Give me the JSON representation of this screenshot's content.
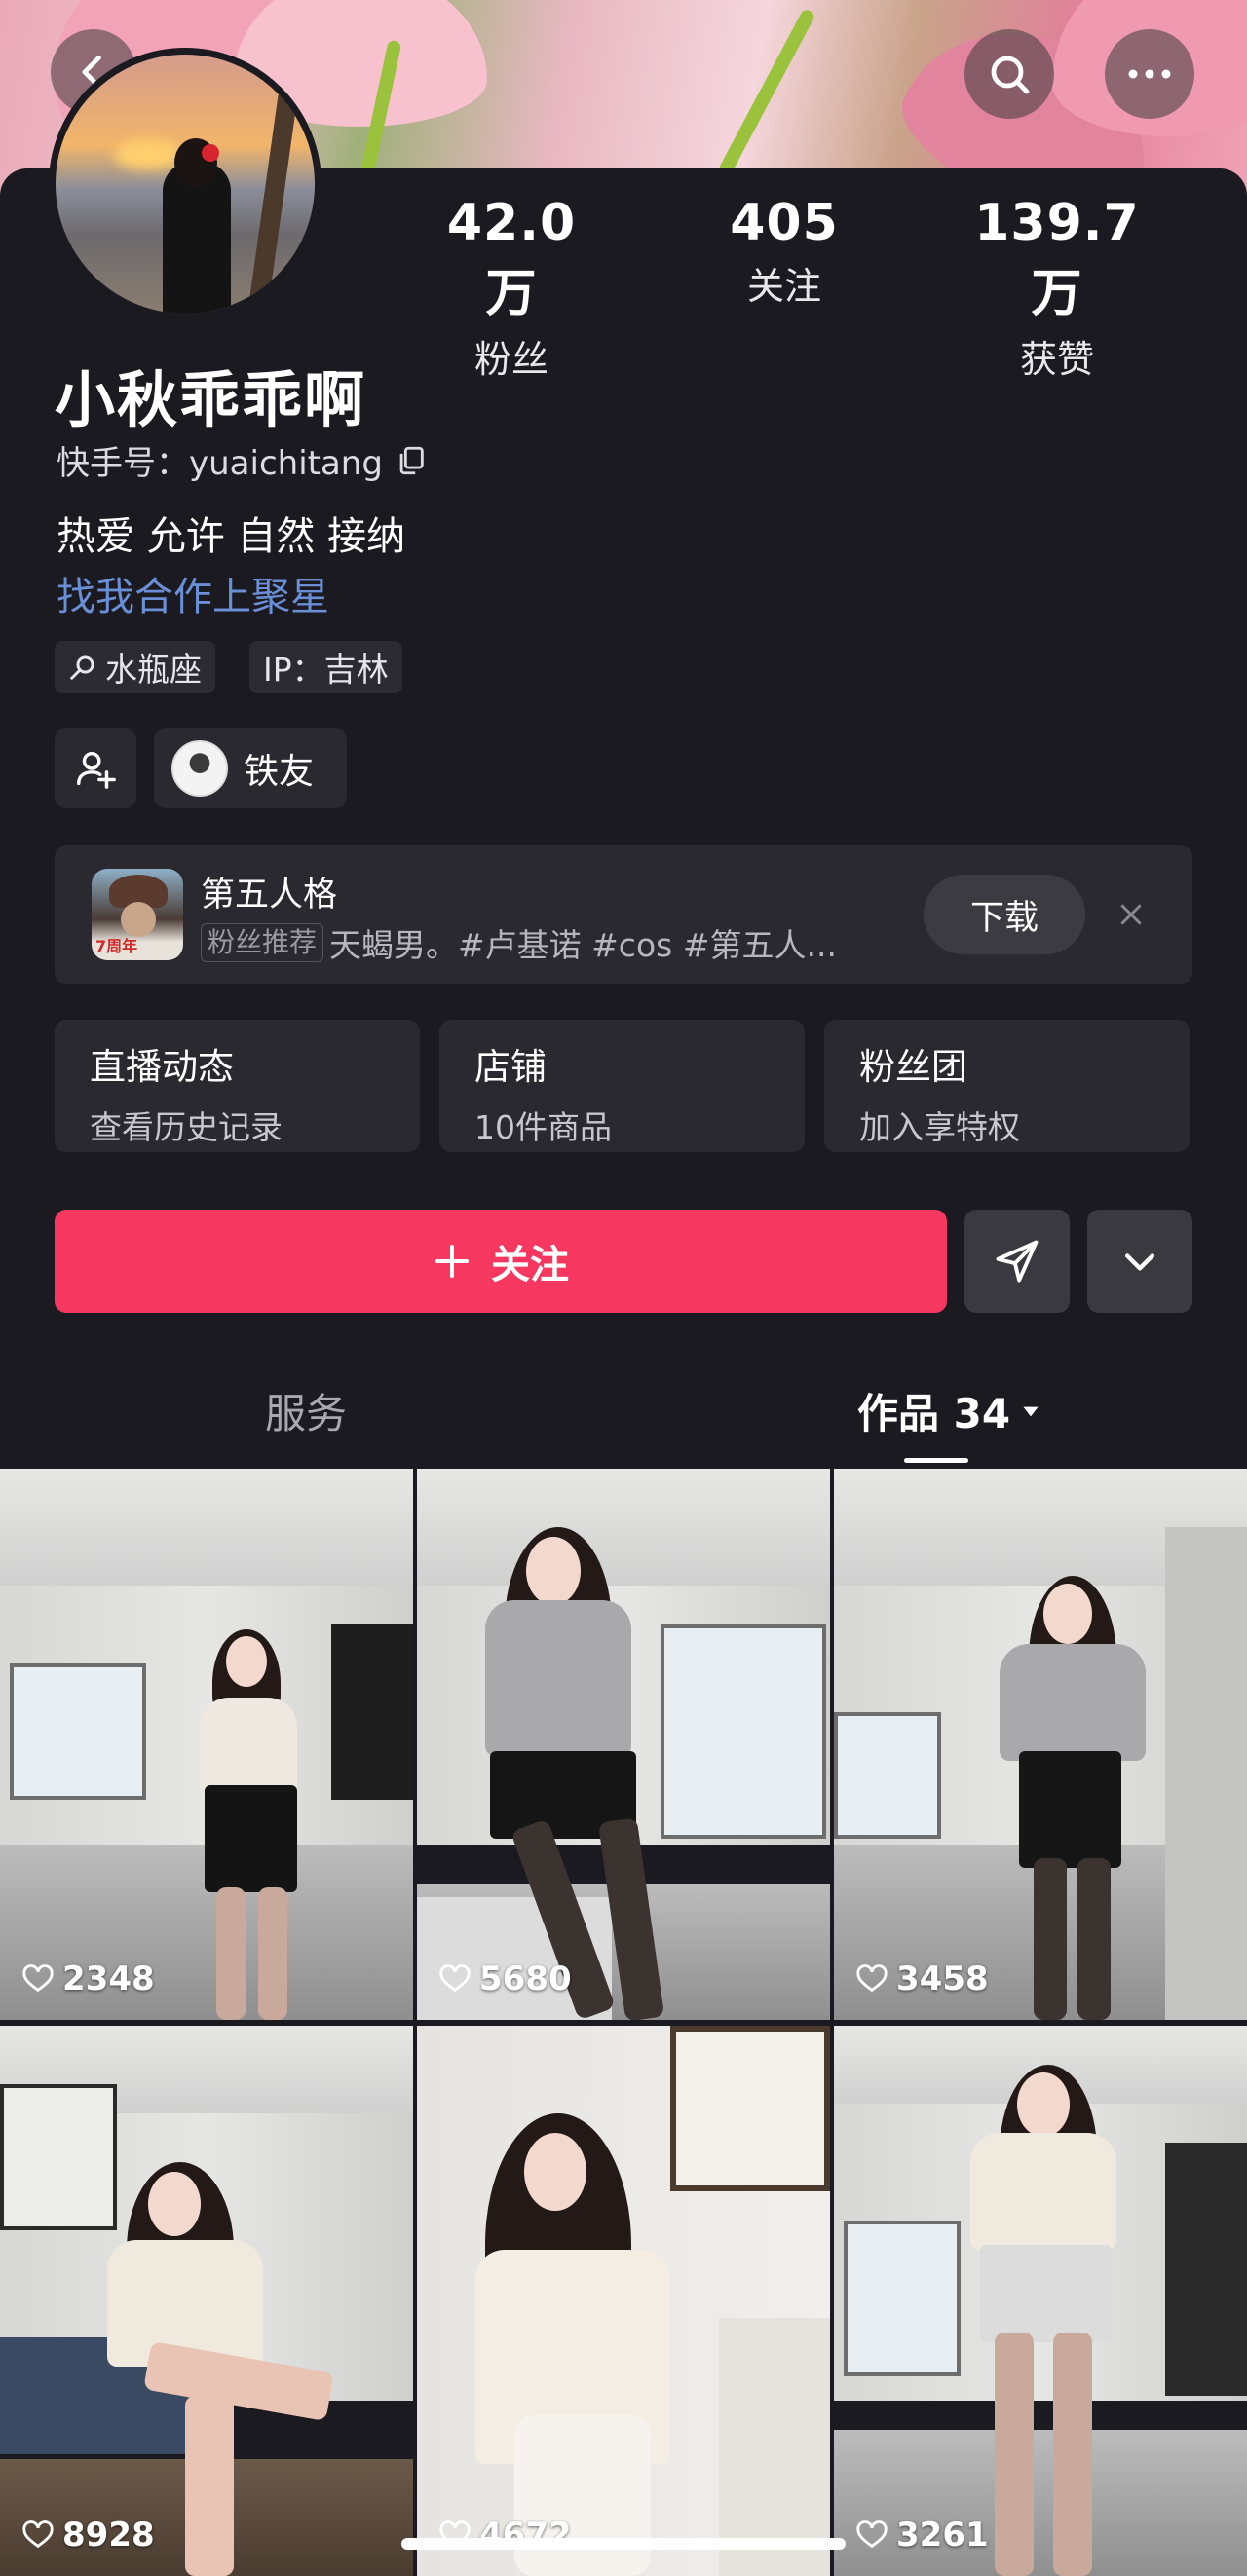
{
  "header": {
    "back_icon": "chevron-left-icon",
    "search_icon": "search-icon",
    "more_icon": "more-dots-icon"
  },
  "profile": {
    "stats": [
      {
        "value": "42.0万",
        "label": "粉丝"
      },
      {
        "value": "405",
        "label": "关注"
      },
      {
        "value": "139.7万",
        "label": "获赞"
      }
    ],
    "name": "小秋乖乖啊",
    "kuaishou_id": "快手号：yuaichitang",
    "bio": "热爱 允许 自然 接纳",
    "link": "找我合作上聚星",
    "tags": [
      "水瓶座",
      "IP：吉林"
    ],
    "friend_label": "铁友"
  },
  "ad": {
    "title": "第五人格",
    "chip": "粉丝推荐",
    "desc": "天蝎男。#卢基诺 #cos #第五人...",
    "download": "下载",
    "badge": "7周年"
  },
  "tiles": [
    {
      "title": "直播动态",
      "sub": "查看历史记录"
    },
    {
      "title": "店铺",
      "sub": "10件商品"
    },
    {
      "title": "粉丝团",
      "sub": "加入享特权"
    }
  ],
  "actions": {
    "follow": "关注"
  },
  "tabs": {
    "services": "服务",
    "works": "作品 34"
  },
  "videos": [
    {
      "likes": "2348"
    },
    {
      "likes": "5680"
    },
    {
      "likes": "3458"
    },
    {
      "likes": "8928"
    },
    {
      "likes": "4672"
    },
    {
      "likes": "3261"
    }
  ],
  "colors": {
    "background": "#1b1a20",
    "accent": "#f6375f",
    "link": "#6b8fd6",
    "surface": "#2a2930"
  }
}
